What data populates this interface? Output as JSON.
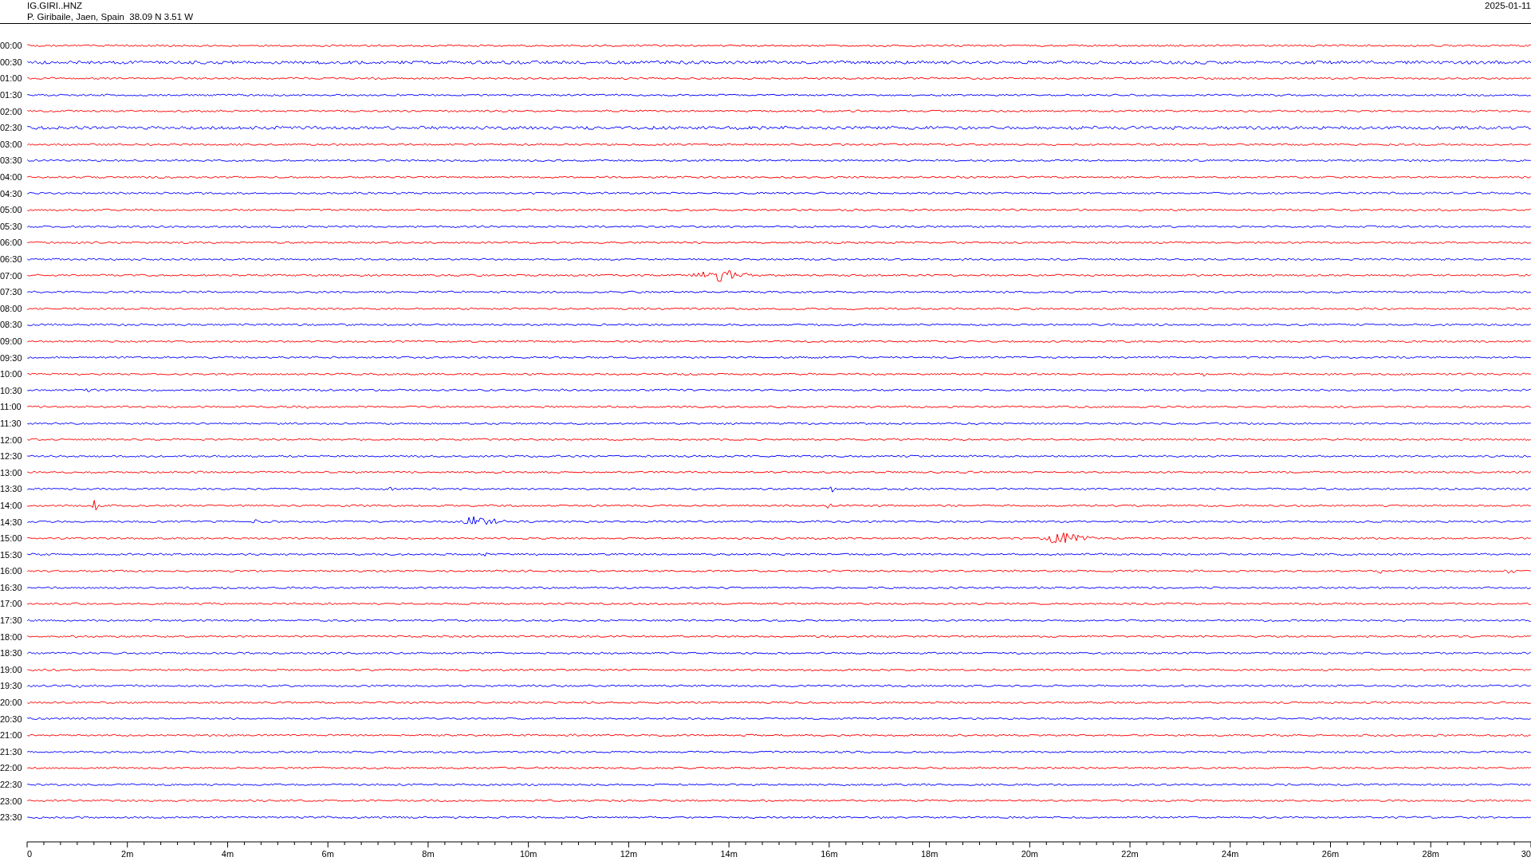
{
  "header": {
    "station": "IG.GIRI..HNZ",
    "location": "P. Giribaile, Jaen, Spain  38.09 N 3.51 W",
    "date": "2025-01-11"
  },
  "traces": [
    {
      "time": "00:00",
      "color": "#ff0000"
    },
    {
      "time": "00:30",
      "color": "#0000ff"
    },
    {
      "time": "01:00",
      "color": "#ff0000"
    },
    {
      "time": "01:30",
      "color": "#0000ff"
    },
    {
      "time": "02:00",
      "color": "#ff0000"
    },
    {
      "time": "02:30",
      "color": "#0000ff"
    },
    {
      "time": "03:00",
      "color": "#ff0000"
    },
    {
      "time": "03:30",
      "color": "#0000ff"
    },
    {
      "time": "04:00",
      "color": "#ff0000"
    },
    {
      "time": "04:30",
      "color": "#0000ff"
    },
    {
      "time": "05:00",
      "color": "#ff0000"
    },
    {
      "time": "05:30",
      "color": "#0000ff"
    },
    {
      "time": "06:00",
      "color": "#ff0000"
    },
    {
      "time": "06:30",
      "color": "#0000ff"
    },
    {
      "time": "07:00",
      "color": "#ff0000"
    },
    {
      "time": "07:30",
      "color": "#0000ff"
    },
    {
      "time": "08:00",
      "color": "#ff0000"
    },
    {
      "time": "08:30",
      "color": "#0000ff"
    },
    {
      "time": "09:00",
      "color": "#ff0000"
    },
    {
      "time": "09:30",
      "color": "#0000ff"
    },
    {
      "time": "10:00",
      "color": "#ff0000"
    },
    {
      "time": "10:30",
      "color": "#0000ff"
    },
    {
      "time": "11:00",
      "color": "#ff0000"
    },
    {
      "time": "11:30",
      "color": "#0000ff"
    },
    {
      "time": "12:00",
      "color": "#ff0000"
    },
    {
      "time": "12:30",
      "color": "#0000ff"
    },
    {
      "time": "13:00",
      "color": "#ff0000"
    },
    {
      "time": "13:30",
      "color": "#0000ff"
    },
    {
      "time": "14:00",
      "color": "#ff0000"
    },
    {
      "time": "14:30",
      "color": "#0000ff"
    },
    {
      "time": "15:00",
      "color": "#ff0000"
    },
    {
      "time": "15:30",
      "color": "#0000ff"
    },
    {
      "time": "16:00",
      "color": "#ff0000"
    },
    {
      "time": "16:30",
      "color": "#0000ff"
    },
    {
      "time": "17:00",
      "color": "#ff0000"
    },
    {
      "time": "17:30",
      "color": "#0000ff"
    },
    {
      "time": "18:00",
      "color": "#ff0000"
    },
    {
      "time": "18:30",
      "color": "#0000ff"
    },
    {
      "time": "19:00",
      "color": "#ff0000"
    },
    {
      "time": "19:30",
      "color": "#0000ff"
    },
    {
      "time": "20:00",
      "color": "#ff0000"
    },
    {
      "time": "20:30",
      "color": "#0000ff"
    },
    {
      "time": "21:00",
      "color": "#ff0000"
    },
    {
      "time": "21:30",
      "color": "#0000ff"
    },
    {
      "time": "22:00",
      "color": "#ff0000"
    },
    {
      "time": "22:30",
      "color": "#0000ff"
    },
    {
      "time": "23:00",
      "color": "#ff0000"
    },
    {
      "time": "23:30",
      "color": "#0000ff"
    }
  ],
  "x_axis": {
    "ticks": [
      "0",
      "2m",
      "4m",
      "6m",
      "8m",
      "10m",
      "12m",
      "14m",
      "16m",
      "18m",
      "20m",
      "22m",
      "24m",
      "26m",
      "28m",
      "30"
    ]
  }
}
